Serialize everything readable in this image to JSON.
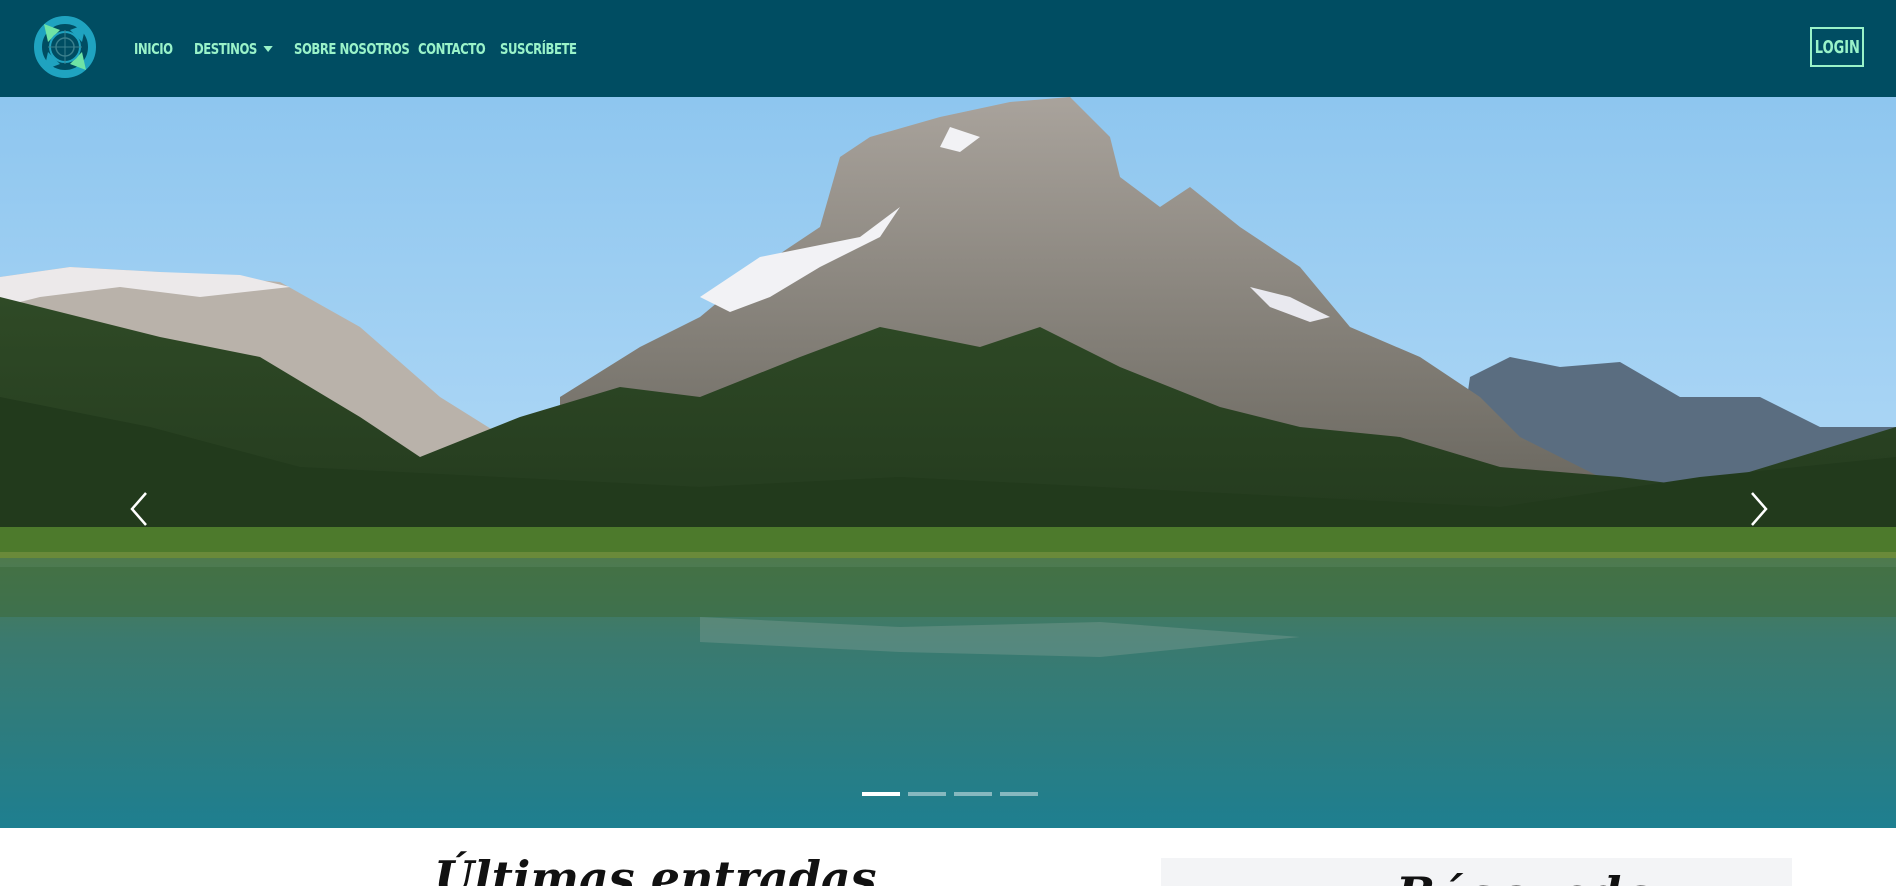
{
  "colors": {
    "navbar_bg": "#004d62",
    "nav_text": "#9af3c9",
    "logo_teal": "#1fa3c0",
    "logo_green": "#6fe3a5"
  },
  "brand": {
    "logo_icon": "compass-logo-icon"
  },
  "nav": {
    "items": [
      {
        "label": "INICIO"
      },
      {
        "label": "DESTINOS"
      },
      {
        "label": "SOBRE NOSOTROS"
      },
      {
        "label": "CONTACTO"
      },
      {
        "label": "SUSCRÍBETE"
      }
    ],
    "login_label": "LOGIN"
  },
  "carousel": {
    "slide_count": 4,
    "active_index": 0,
    "prev_icon": "chevron-left-icon",
    "next_icon": "chevron-right-icon"
  },
  "main": {
    "latest_heading": "Últimas entradas",
    "sidebar_heading": "Búsqueda"
  }
}
